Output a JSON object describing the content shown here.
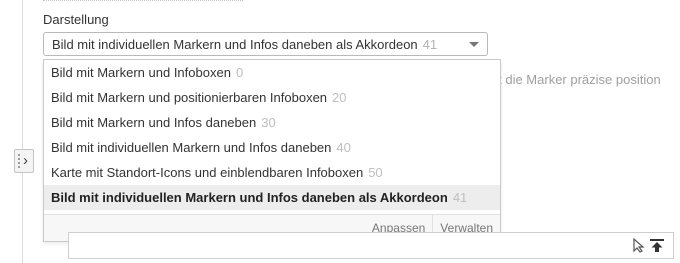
{
  "field": {
    "label": "Darstellung",
    "selected_text": "Bild mit individuellen Markern und Infos daneben als Akkordeon",
    "selected_value": "41"
  },
  "hint_text": "nit die Marker präzise position",
  "options": [
    {
      "label": "Bild mit Markern und Infoboxen",
      "value": "0"
    },
    {
      "label": "Bild mit Markern und positionierbaren Infoboxen",
      "value": "20"
    },
    {
      "label": "Bild mit Markern und Infos daneben",
      "value": "30"
    },
    {
      "label": "Bild mit individuellen Markern und Infos daneben",
      "value": "40"
    },
    {
      "label": "Karte mit Standort-Icons und einblendbaren Infoboxen",
      "value": "50"
    },
    {
      "label": "Bild mit individuellen Markern und Infos daneben als Akkordeon",
      "value": "41"
    }
  ],
  "actions": {
    "adjust": "Anpassen",
    "manage": "Verwalten"
  },
  "icons": {
    "sidebar_toggle": "chevron-right-icon",
    "cursor": "cursor-icon",
    "upload": "upload-icon"
  }
}
